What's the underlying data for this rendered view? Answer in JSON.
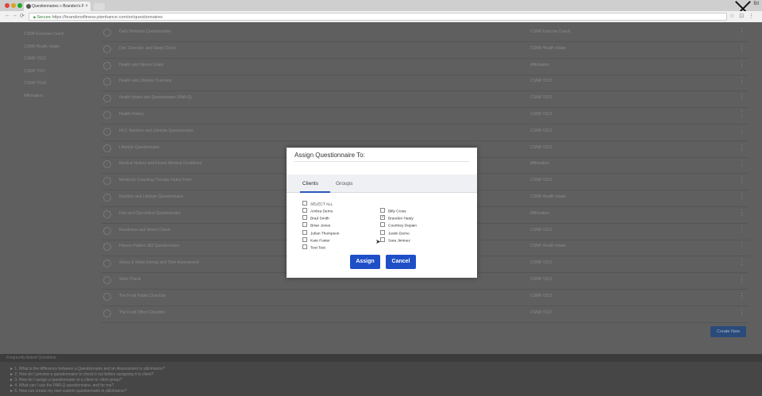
{
  "browser": {
    "tab_title": "Questionnaires » Brandon's F",
    "tab_close": "×",
    "url_secure": "Secure",
    "url_rest": "https://brandonsfitness.ptenhance.com/en/questionnaires",
    "user": "Bil"
  },
  "sidebar": {
    "items": [
      "CSNR Exercise Coach",
      "CSNR Health Intake",
      "CSNR YS13",
      "CSNR YS17",
      "CSNR YS18",
      "Affirmation"
    ]
  },
  "table": {
    "rows": [
      {
        "name": "Daily Wellness Questionnaire",
        "group": "CSNR Exercise Coach"
      },
      {
        "name": "Diet, Exercise, and Sleep Check",
        "group": "CSNR Health Intake"
      },
      {
        "name": "Health and Fitness Goals",
        "group": "Affirmation"
      },
      {
        "name": "Health and Lifestyle Overview",
        "group": "CSNR YS13"
      },
      {
        "name": "Health Intake and Questionnaire (PAR-Q)",
        "group": "CSNR YS13"
      },
      {
        "name": "Health History",
        "group": "CSNR YS13"
      },
      {
        "name": "HLC: Nutrition and Lifestyle Questionnaire",
        "group": "CSNR YS13"
      },
      {
        "name": "Lifestyle Questionnaire",
        "group": "CSNR YS13"
      },
      {
        "name": "Medical History and Known Medical Conditions",
        "group": "Affirmation"
      },
      {
        "name": "Metabolic Coaching Therapy Intake Form",
        "group": "CSNR YS13"
      },
      {
        "name": "Nutrition and Lifestyle Questionnaire",
        "group": "CSNR Health Intake"
      },
      {
        "name": "Pain and Discomfort Questionnaire",
        "group": "Affirmation"
      },
      {
        "name": "Readiness and Stress Check",
        "group": "CSNR YS13"
      },
      {
        "name": "Fitness Pattern 360 Questionnaire",
        "group": "CSNR Health Intake"
      },
      {
        "name": "Stress & Wake Energy and Time Assessment",
        "group": "CSNR YS13"
      },
      {
        "name": "Store Check",
        "group": "CSNR YS13"
      },
      {
        "name": "The Food Habits Checklist",
        "group": "CSNR YS13"
      },
      {
        "name": "The Food Office Checklist",
        "group": "CSNR YS13"
      }
    ],
    "create_label": "Create New"
  },
  "footer": {
    "header": "Frequently Asked Questions",
    "faqs": [
      "► 1. What is the difference between a Questionnaire and an Assessment in ptEnhance?",
      "► 2. How do I preview a questionnaire to check it out before assigning it to client?",
      "► 3. How do I assign a questionnaire to a client or client group?",
      "► 4. What can I use the PAR-Q questionnaire, and for me?",
      "► 5. How can create my own custom questionnaire in ptEnhance?"
    ]
  },
  "modal": {
    "title": "Assign Questionnaire To:",
    "tabs": {
      "clients": "Clients",
      "groups": "Groups"
    },
    "select_all": "SELECT ALL",
    "left_clients": [
      "Ambra Demo",
      "Brad Smith",
      "Brian Jones",
      "Julian Thompson",
      "Kate Foster",
      "Test Test"
    ],
    "right_clients": [
      "Billy Cross",
      "Brandon Hasty",
      "Courtney Depain",
      "Justin Demo",
      "Sara Jiminez"
    ],
    "checked_right_index": 1,
    "assign_label": "Assign",
    "cancel_label": "Cancel"
  }
}
